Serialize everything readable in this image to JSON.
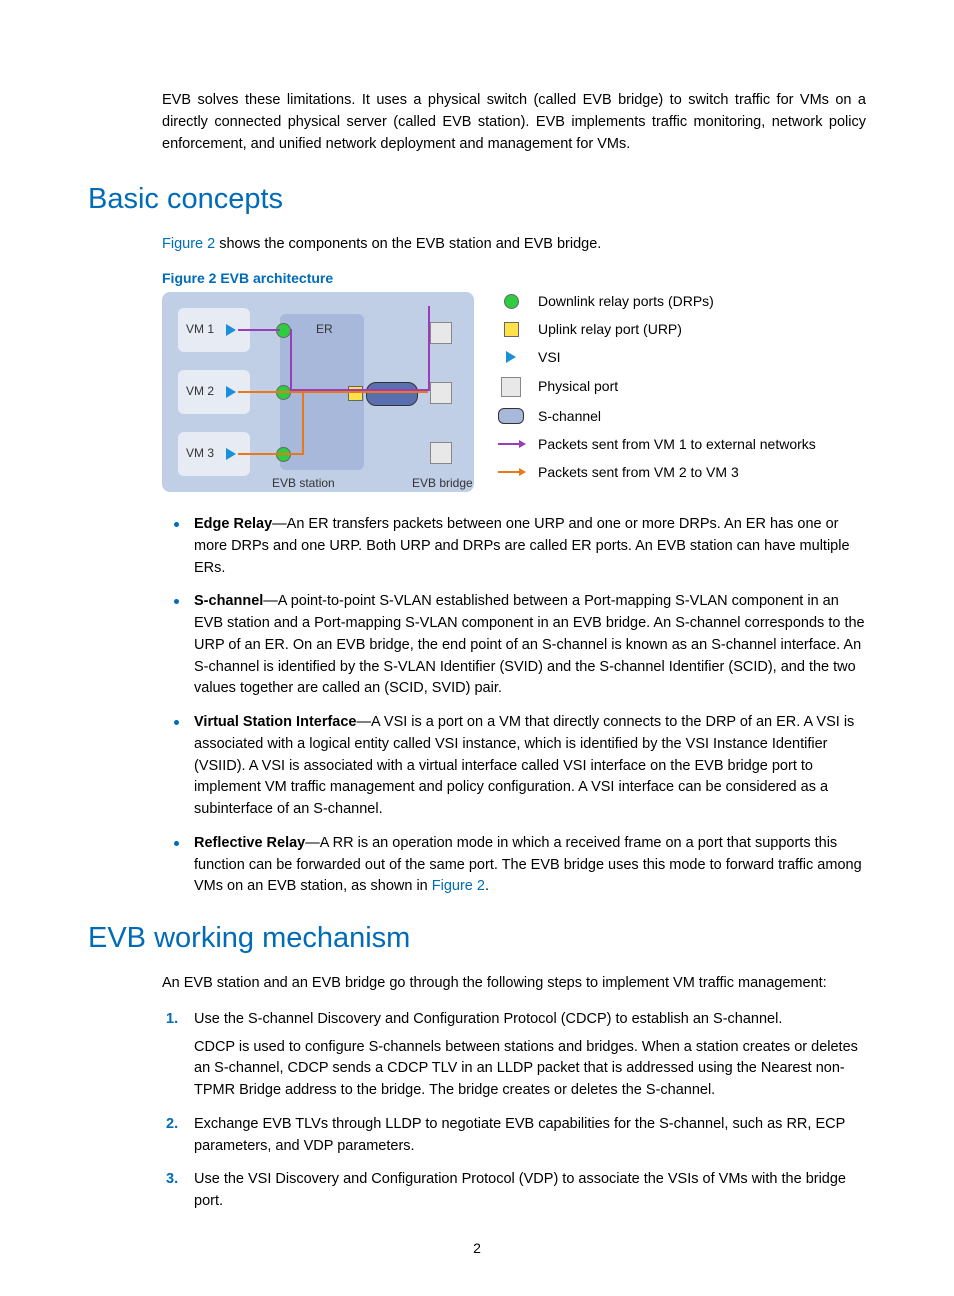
{
  "intro": "EVB solves these limitations. It uses a physical switch (called EVB bridge) to switch traffic for VMs on a directly connected physical server (called EVB station). EVB implements traffic monitoring, network policy enforcement, and unified network deployment and management for VMs.",
  "h1_concepts": "Basic concepts",
  "caption_pre": "Figure 2",
  "caption_post": " shows the components on the EVB station and EVB bridge.",
  "fig_title": "Figure 2 EVB architecture",
  "diagram": {
    "vm1": "VM 1",
    "vm2": "VM 2",
    "vm3": "VM 3",
    "er": "ER",
    "station": "EVB station",
    "bridge": "EVB bridge"
  },
  "legend": {
    "drp": "Downlink relay ports (DRPs)",
    "urp": "Uplink relay port (URP)",
    "vsi": "VSI",
    "pport": "Physical port",
    "schannel": "S-channel",
    "purple": "Packets sent from VM 1 to external networks",
    "orange": "Packets sent from VM 2 to VM 3"
  },
  "concepts": [
    {
      "term": "Edge Relay",
      "body": "—An ER transfers packets between one URP and one or more DRPs. An ER has one or more DRPs and one URP. Both URP and DRPs are called ER ports. An EVB station can have multiple ERs."
    },
    {
      "term": "S-channel",
      "body": "—A point-to-point S-VLAN established between a Port-mapping S-VLAN component in an EVB station and a Port-mapping S-VLAN component in an EVB bridge. An S-channel corresponds to the URP of an ER. On an EVB bridge, the end point of an S-channel is known as an S-channel interface. An S-channel is identified by the S-VLAN Identifier (SVID) and the S-channel Identifier (SCID), and the two values together are called an (SCID, SVID) pair."
    },
    {
      "term": "Virtual Station Interface",
      "body": "—A VSI is a port on a VM that directly connects to the DRP of an ER. A VSI is associated with a logical entity called VSI instance, which is identified by the VSI Instance Identifier (VSIID). A VSI is associated with a virtual interface called VSI interface on the EVB bridge port to implement VM traffic management and policy configuration. A VSI interface can be considered as a subinterface of an S-channel."
    },
    {
      "term": "Reflective Relay",
      "body_pre": "—A RR is an operation mode in which a received frame on a port that supports this function can be forwarded out of the same port. The EVB bridge uses this mode to forward traffic among VMs on an EVB station, as shown in ",
      "figref": "Figure 2",
      "body_post": "."
    }
  ],
  "h1_mech": "EVB working mechanism",
  "mech_intro": "An EVB station and an EVB bridge go through the following steps to implement VM traffic management:",
  "steps": [
    {
      "t": "Use the S-channel Discovery and Configuration Protocol (CDCP) to establish an S-channel.",
      "p": "CDCP is used to configure S-channels between stations and bridges. When a station creates or deletes an S-channel, CDCP sends a CDCP TLV in an LLDP packet that is addressed using the Nearest non-TPMR Bridge address to the bridge. The bridge creates or deletes the S-channel."
    },
    {
      "t": "Exchange EVB TLVs through LLDP to negotiate EVB capabilities for the S-channel, such as RR, ECP parameters, and VDP parameters."
    },
    {
      "t": "Use the VSI Discovery and Configuration Protocol (VDP) to associate the VSIs of VMs with the bridge port."
    }
  ],
  "page_number": "2"
}
